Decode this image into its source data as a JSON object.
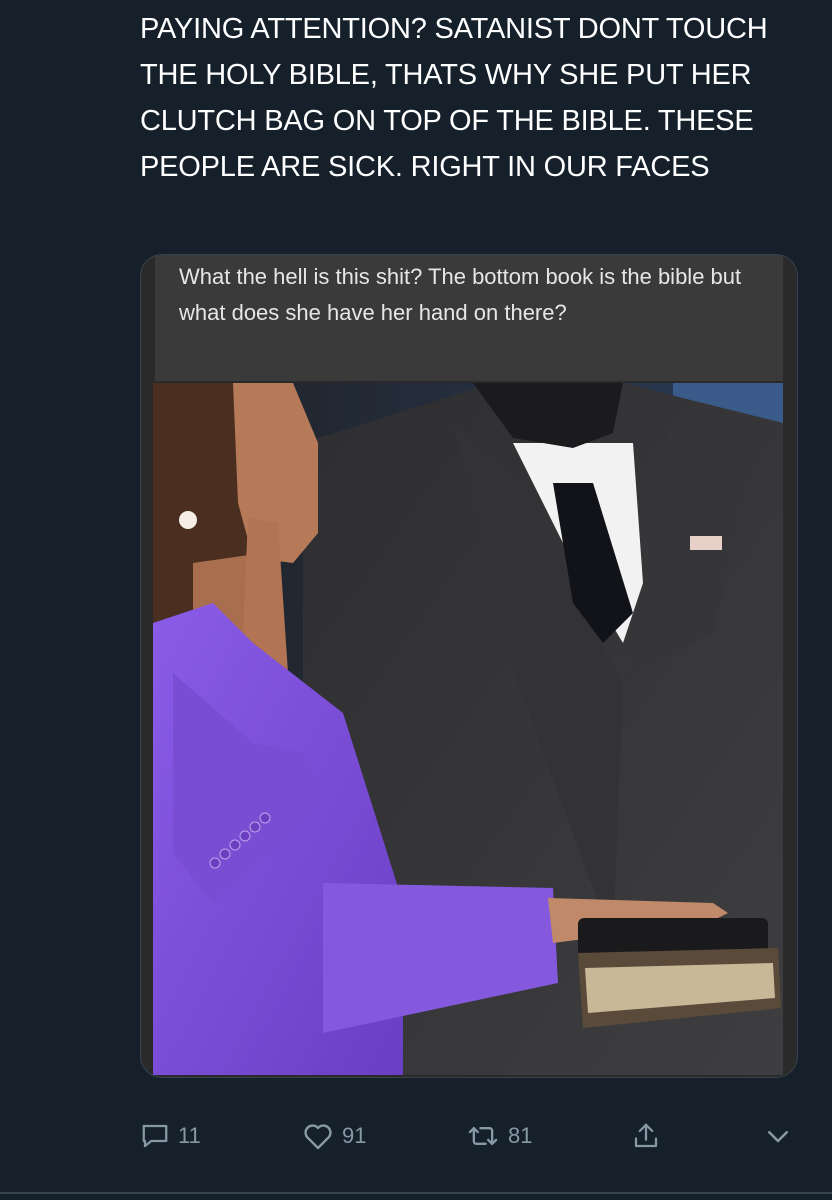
{
  "tweet": {
    "text": "PAYING ATTENTION? SATANIST DONT TOUCH THE HOLY BIBLE, THATS WHY SHE PUT HER CLUTCH BAG ON TOP OF THE BIBLE. THESE PEOPLE ARE SICK. RIGHT IN OUR FACES"
  },
  "media": {
    "caption": "What the hell is this shit? The bottom book is the bible but what does she have her hand on there?"
  },
  "actions": {
    "reply_count": "11",
    "like_count": "91",
    "retweet_count": "81"
  },
  "icons": {
    "reply": "reply-icon",
    "like": "heart-icon",
    "retweet": "retweet-icon",
    "share": "share-icon",
    "more": "chevron-down-icon"
  },
  "colors": {
    "background": "#15202b",
    "icon_gray": "#8899a6",
    "purple_suit": "#7b4fd6"
  }
}
